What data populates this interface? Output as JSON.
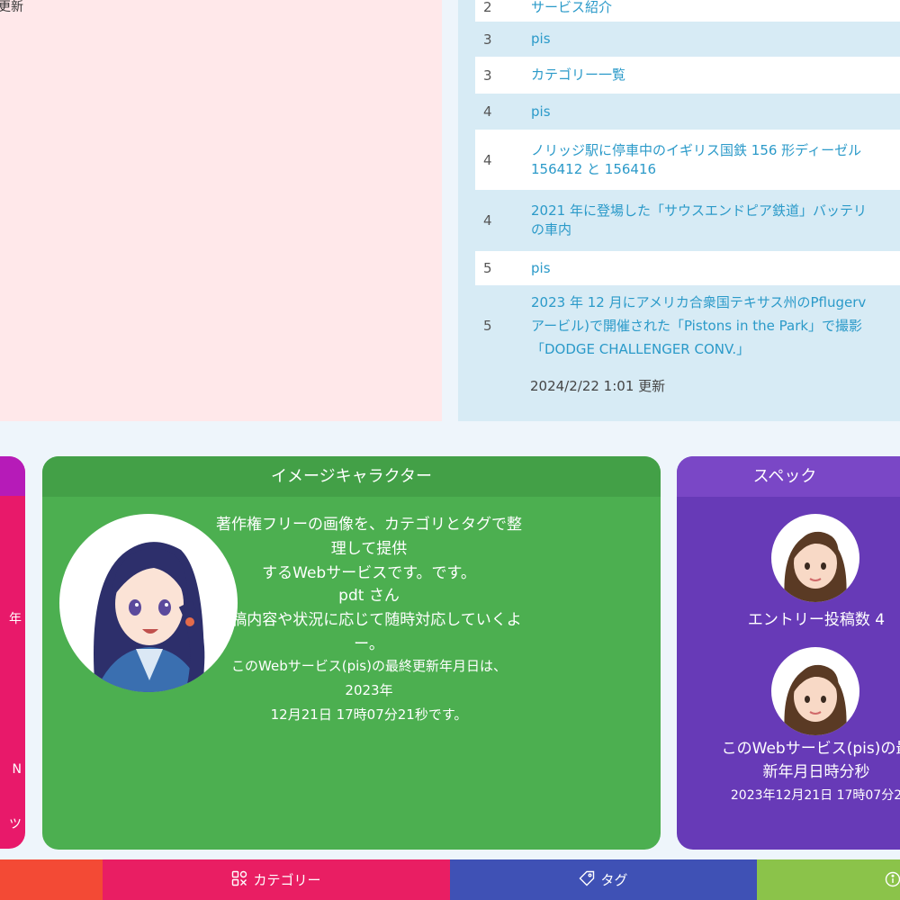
{
  "pink_panel": {
    "updated_text": "更新"
  },
  "list": {
    "rows": [
      {
        "num": "2",
        "text": "サービス紹介"
      },
      {
        "num": "3",
        "text": "pis"
      },
      {
        "num": "3",
        "text": "カテゴリー一覧"
      },
      {
        "num": "4",
        "text": "pis"
      },
      {
        "num": "4",
        "text": "ノリッジ駅に停車中のイギリス国鉄 156 形ディーゼル",
        "text2": "156412 と 156416"
      },
      {
        "num": "4",
        "text": "2021 年に登場した「サウスエンドピア鉄道」バッテリ",
        "text2": "の車内"
      },
      {
        "num": "5",
        "text": "pis"
      },
      {
        "num": "5",
        "text": "2023 年 12 月にアメリカ合衆国テキサス州のPflugerv",
        "text2": "アービル)で開催された「Pistons in the Park」で撮影",
        "text3": "「DODGE CHALLENGER CONV.」"
      }
    ],
    "updated": "2024/2/22 1:01 更新"
  },
  "left_card": {
    "fragments": [
      "年",
      "N",
      "ツ"
    ]
  },
  "image_card": {
    "title": "イメージキャラクター",
    "desc_line1": "著作権フリーの画像を、カテゴリとタグで整理して提供",
    "desc_line2": "するWebサービスです。です。",
    "author": "pdt さん",
    "author_note": "投稿内容や状況に応じて随時対応していくよー。",
    "update_line1": "このWebサービス(pis)の最終更新年月日は、2023年",
    "update_line2": "12月21日 17時07分21秒です。"
  },
  "spec_card": {
    "title": "スペック",
    "entry_count": "エントリー投稿数 4",
    "update_label1": "このWebサービス(pis)の最",
    "update_label2": "新年月日時分秒",
    "update_value": "2023年12月21日 17時07分2"
  },
  "bottom_nav": {
    "category_label": "カテゴリー",
    "tag_label": "タグ",
    "category_icon": "category-icon",
    "tag_icon": "tag-icon",
    "info_icon": "info-icon"
  },
  "colors": {
    "green": "#4caf50",
    "purple": "#673ab7",
    "pink": "#e91e63",
    "blue": "#3f51b5",
    "lime": "#8bc34a",
    "red": "#f34a35"
  }
}
